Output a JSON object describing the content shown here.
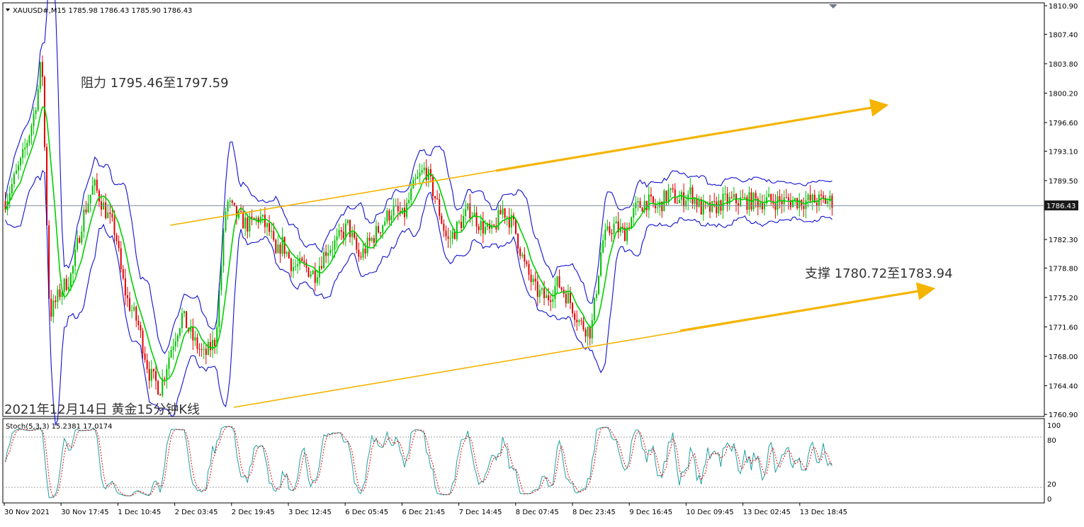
{
  "chart_data": [
    {
      "type": "line",
      "title": "",
      "symbol_header": "XAUUSD#,M15  1785.98 1786.43 1785.90 1786.43",
      "ylim": [
        1760.9,
        1810.9
      ],
      "y_ticks": [
        "1810.90",
        "1807.40",
        "1803.80",
        "1800.20",
        "1796.60",
        "1793.10",
        "1789.50",
        "1786.43",
        "1782.30",
        "1778.80",
        "1775.20",
        "1771.60",
        "1768.00",
        "1764.40",
        "1760.90"
      ],
      "current_price": "1786.43",
      "x_labels": [
        "30 Nov 2021",
        "30 Nov 17:45",
        "1 Dec 10:45",
        "2 Dec 03:45",
        "2 Dec 19:45",
        "3 Dec 12:45",
        "6 Dec 05:45",
        "6 Dec 21:45",
        "7 Dec 14:45",
        "8 Dec 07:45",
        "8 Dec 23:45",
        "9 Dec 16:45",
        "10 Dec 09:45",
        "13 Dec 02:45",
        "13 Dec 18:45"
      ],
      "price_path": {
        "x": [
          0,
          3,
          5,
          6,
          6.6,
          7,
          8,
          10,
          12,
          14,
          16,
          18,
          20,
          21,
          22,
          24,
          26,
          28,
          30,
          32,
          34,
          36,
          38,
          40,
          42,
          44,
          46,
          48,
          49,
          50,
          52,
          54,
          56,
          58,
          60,
          62,
          64,
          66,
          68,
          70,
          72,
          74,
          76,
          78,
          80,
          82,
          84,
          86,
          88,
          90,
          92,
          94,
          96,
          98,
          100,
          102,
          104,
          106,
          108,
          110,
          112,
          114,
          116,
          118,
          120,
          122,
          124,
          126,
          128,
          130,
          132,
          134,
          136,
          138,
          140,
          142,
          144,
          146,
          148,
          150,
          152,
          154,
          156,
          158,
          160,
          162,
          164,
          166,
          168,
          170,
          172,
          174,
          176,
          178,
          180,
          182,
          184,
          186,
          188,
          190,
          192,
          194,
          196,
          198,
          200
        ],
        "y": [
          1787,
          1792,
          1797,
          1801,
          1805,
          1796,
          1773,
          1776,
          1778,
          1785,
          1789,
          1786,
          1783,
          1778,
          1775,
          1772,
          1766,
          1764,
          1769,
          1773,
          1770,
          1768,
          1770,
          1787,
          1785,
          1784,
          1785,
          1783,
          1780,
          1782,
          1779,
          1779,
          1778,
          1781,
          1782,
          1784,
          1780,
          1782,
          1784,
          1786,
          1785,
          1789,
          1791,
          1787,
          1782,
          1784,
          1786,
          1784,
          1783,
          1786,
          1784,
          1779,
          1776,
          1775,
          1777,
          1775,
          1772,
          1771,
          1782,
          1784,
          1783,
          1786,
          1787,
          1786,
          1788,
          1787,
          1788,
          1786,
          1786,
          1787,
          1787,
          1787,
          1787,
          1787,
          1787,
          1787,
          1787,
          1787,
          1787,
          1787,
          1787,
          1787,
          1787,
          1787,
          1787,
          1787,
          1787,
          1787,
          1787,
          1787,
          1787,
          1787,
          1787,
          1787,
          1787,
          1787,
          1787,
          1787,
          1787,
          1787,
          1787,
          1787,
          1787,
          1787,
          1787,
          1787
        ]
      }
    },
    {
      "type": "line",
      "title": "",
      "indicator_header": "Stoch(5,3,3) 15.2381 17.0174",
      "ylim": [
        0,
        100
      ],
      "y_ticks": [
        "100",
        "80",
        "20",
        "0"
      ],
      "levels": [
        80,
        20
      ]
    }
  ],
  "annotations": {
    "resistance": "阻力 1795.46至1797.59",
    "support": "支撑 1780.72至1783.94",
    "caption": "2021年12月14日 黄金15分钟K线"
  },
  "colors": {
    "bull_candle": "#00c000",
    "bear_candle": "#e00000",
    "bands": "#1010d0",
    "ma": "#00d000",
    "trend": "#f5b400",
    "stoch_main": "#20a0a0",
    "stoch_signal": "#e00000",
    "price_line": "#7f8c99"
  }
}
